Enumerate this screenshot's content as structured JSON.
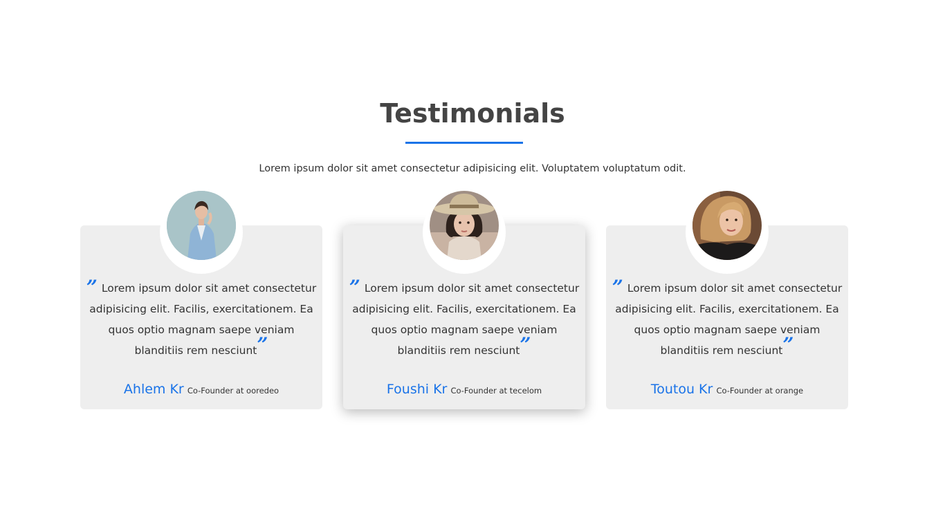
{
  "header": {
    "title": "Testimonials",
    "subtitle": "Lorem ipsum dolor sit amet consectetur adipisicing elit. Voluptatem voluptatum odit."
  },
  "accent_color": "#1a73e8",
  "testimonials": [
    {
      "quote": "Lorem ipsum dolor sit amet consectetur adipisicing elit. Facilis, exercitationem. Ea quos optio magnam saepe veniam blanditiis rem nesciunt",
      "name": "Ahlem Kr",
      "role": "Co-Founder at ooredeo",
      "avatar": "woman-in-blue-blazer-photo"
    },
    {
      "quote": "Lorem ipsum dolor sit amet consectetur adipisicing elit. Facilis, exercitationem. Ea quos optio magnam saepe veniam blanditiis rem nesciunt",
      "name": "Foushi Kr",
      "role": "Co-Founder at tecelom",
      "avatar": "woman-in-hat-photo"
    },
    {
      "quote": "Lorem ipsum dolor sit amet consectetur adipisicing elit. Facilis, exercitationem. Ea quos optio magnam saepe veniam blanditiis rem nesciunt",
      "name": "Toutou Kr",
      "role": "Co-Founder at orange",
      "avatar": "smiling-blonde-woman-photo"
    }
  ],
  "quote_marks": {
    "open": "”",
    "close": "”"
  }
}
